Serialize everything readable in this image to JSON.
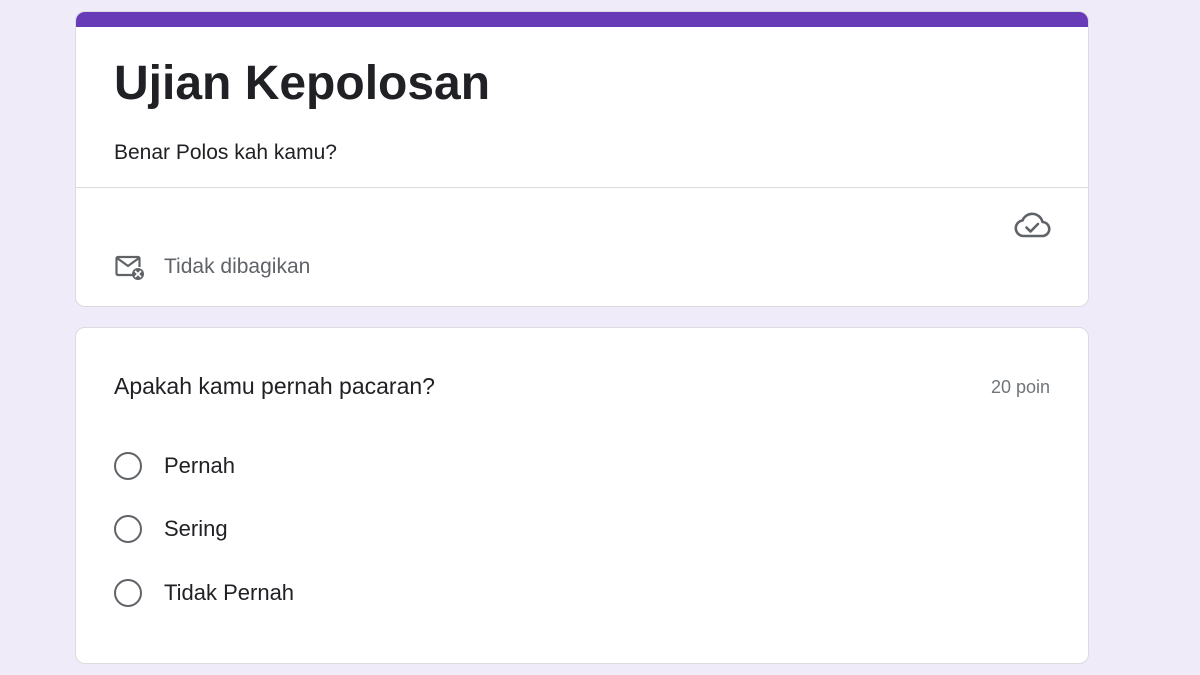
{
  "theme": {
    "accent": "#673ab7",
    "background": "#efebf8",
    "card": "#ffffff",
    "border": "#dadce0",
    "secondary_text": "#5f6368"
  },
  "header": {
    "title": "Ujian Kepolosan",
    "description": "Benar Polos kah kamu?",
    "share_status": "Tidak dibagikan",
    "share_icon": "mail-off-icon",
    "save_status_icon": "cloud-done-icon"
  },
  "question": {
    "title": "Apakah kamu pernah pacaran?",
    "points": "20 poin",
    "options": [
      {
        "label": "Pernah"
      },
      {
        "label": "Sering"
      },
      {
        "label": "Tidak Pernah"
      }
    ]
  }
}
